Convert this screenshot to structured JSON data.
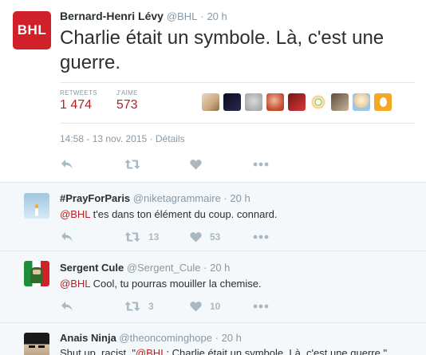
{
  "tweet": {
    "author_initials": "BHL",
    "author_name": "Bernard-Henri Lévy",
    "author_handle": "@BHL",
    "separator": "·",
    "time_ago": "20 h",
    "text": "Charlie était un symbole. Là, c'est une guerre.",
    "retweets_label": "RETWEETS",
    "retweets_count": "1 474",
    "likes_label": "J'AIME",
    "likes_count": "573",
    "timestamp": "14:58 - 13 nov. 2015",
    "details_link": "Détails",
    "accent_color": "#b42324"
  },
  "replies": [
    {
      "name": "#PrayForParis",
      "handle": "@niketagrammaire",
      "separator": "·",
      "time_ago": "20 h",
      "mention": "@BHL",
      "text": " t'es dans ton élément du coup. connard.",
      "retweet_count": "13",
      "like_count": "53"
    },
    {
      "name": "Sergent Cule",
      "handle": "@Sergent_Cule",
      "separator": "·",
      "time_ago": "20 h",
      "mention": "@BHL",
      "text": " Cool, tu pourras mouiller la chemise.",
      "retweet_count": "3",
      "like_count": "10"
    },
    {
      "name": "Anais Ninja",
      "handle": "@theoncominghope",
      "separator": "·",
      "time_ago": "20 h",
      "text_before": "Shut up, racist. \"",
      "mention": "@BHL",
      "text_after": ": Charlie était un symbole. Là, c'est une guerre.\""
    }
  ]
}
